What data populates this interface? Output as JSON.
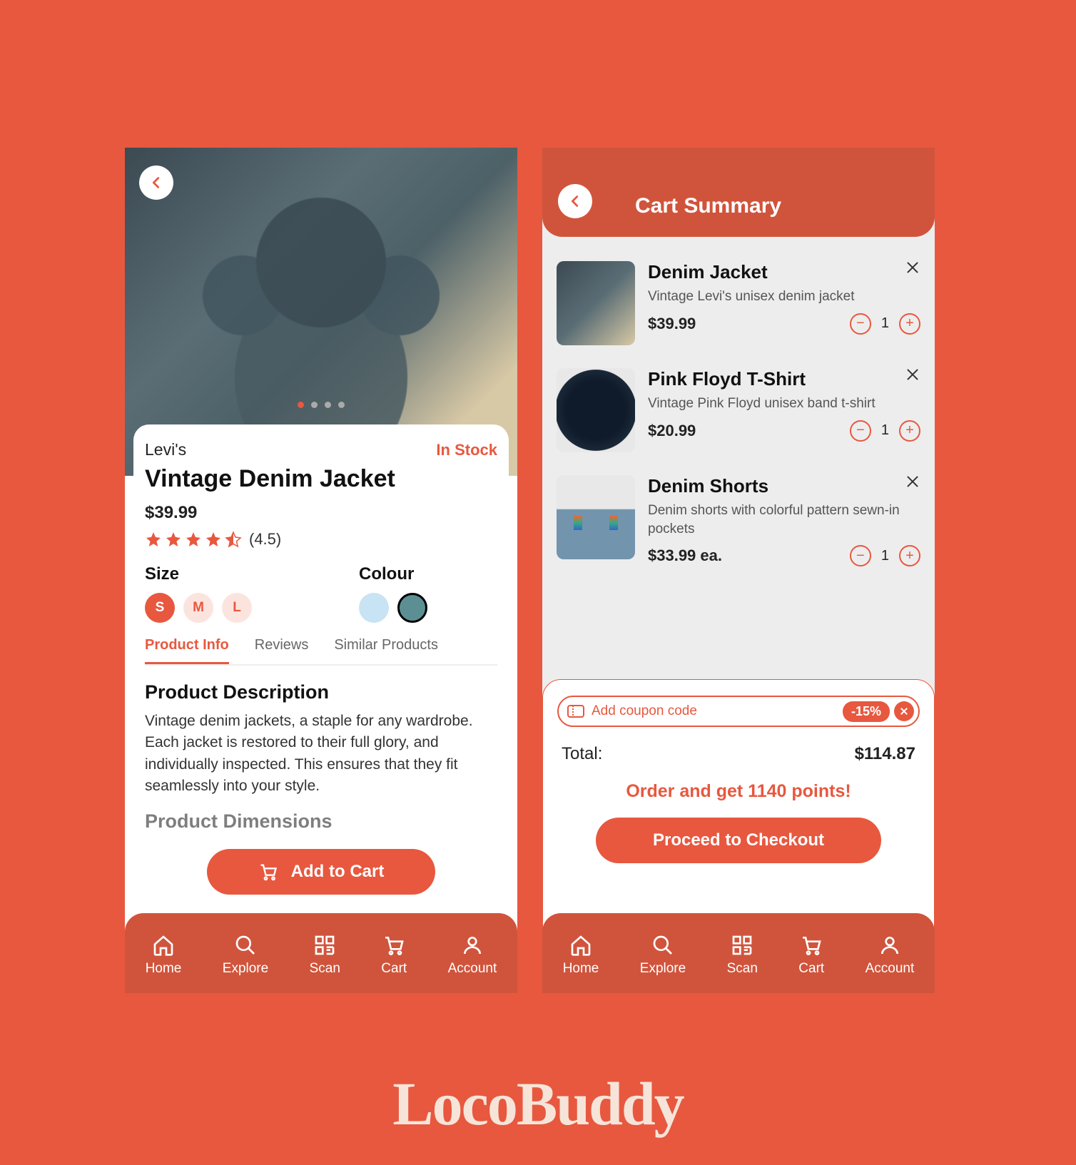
{
  "brandLogo": "LocoBuddy",
  "nav": [
    "Home",
    "Explore",
    "Scan",
    "Cart",
    "Account"
  ],
  "product": {
    "brand": "Levi's",
    "stock": "In Stock",
    "title": "Vintage Denim Jacket",
    "price": "$39.99",
    "rating": "(4.5)",
    "sizeLabel": "Size",
    "sizes": [
      "S",
      "M",
      "L"
    ],
    "colourLabel": "Colour",
    "tabs": [
      "Product Info",
      "Reviews",
      "Similar Products"
    ],
    "descHead": "Product Description",
    "desc": "Vintage denim jackets, a staple for any wardrobe. Each jacket is restored to their full glory, and individually inspected. This ensures that they fit seamlessly into your style.",
    "dimHead": "Product Dimensions",
    "addCart": "Add to Cart"
  },
  "cart": {
    "title": "Cart Summary",
    "items": [
      {
        "name": "Denim Jacket",
        "desc": "Vintage Levi's unisex denim jacket",
        "price": "$39.99",
        "qty": "1"
      },
      {
        "name": "Pink Floyd T-Shirt",
        "desc": "Vintage Pink Floyd unisex band t-shirt",
        "price": "$20.99",
        "qty": "1"
      },
      {
        "name": "Denim Shorts",
        "desc": "Denim shorts with colorful pattern sewn-in pockets",
        "price": "$33.99 ea.",
        "qty": "1"
      }
    ],
    "couponPh": "Add coupon code",
    "discount": "-15%",
    "totalLabel": "Total:",
    "totalValue": "$114.87",
    "points": "Order and get 1140 points!",
    "checkout": "Proceed to Checkout"
  }
}
